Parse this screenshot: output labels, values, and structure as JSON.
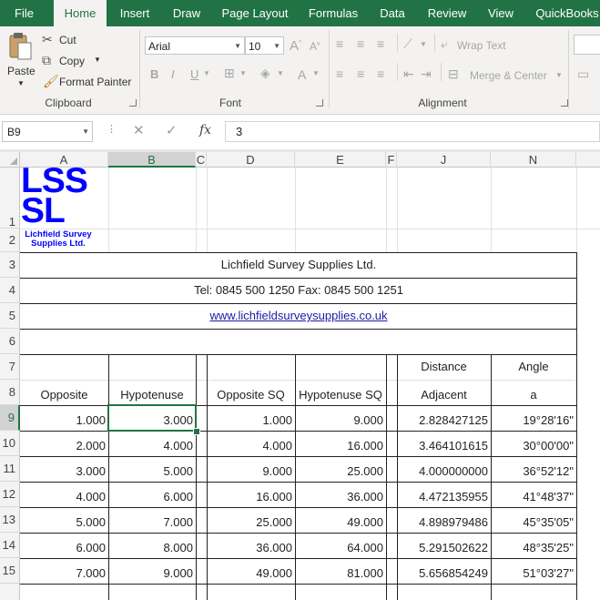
{
  "ribbon": {
    "tabs": [
      "File",
      "Home",
      "Insert",
      "Draw",
      "Page Layout",
      "Formulas",
      "Data",
      "Review",
      "View",
      "QuickBooks"
    ],
    "active_tab": "Home",
    "clipboard": {
      "paste": "Paste",
      "cut": "Cut",
      "copy": "Copy",
      "format_painter": "Format Painter",
      "label": "Clipboard"
    },
    "font": {
      "name": "Arial",
      "size": "10",
      "label": "Font",
      "bold": "B",
      "italic": "I",
      "underline": "U"
    },
    "alignment": {
      "wrap_text": "Wrap Text",
      "merge_center": "Merge & Center",
      "label": "Alignment"
    }
  },
  "formula_bar": {
    "name_box": "B9",
    "value": "3",
    "fx": "fx"
  },
  "columns": [
    "A",
    "B",
    "C",
    "D",
    "E",
    "F",
    "J",
    "N"
  ],
  "selected_column": "B",
  "rows": [
    "1",
    "2",
    "3",
    "4",
    "5",
    "6",
    "7",
    "8",
    "9",
    "10",
    "11",
    "12",
    "13",
    "14",
    "15"
  ],
  "selected_row": "9",
  "logo": {
    "letters_top": "LSS",
    "letters_bottom": "SL",
    "name_line1": "Lichfield Survey",
    "name_line2": "Supplies Ltd.",
    "color": "#0000ff"
  },
  "sheet": {
    "company": "Lichfield Survey Supplies Ltd.",
    "phone": "Tel: 0845 500 1250  Fax: 0845 500 1251",
    "website": "www.lichfieldsurveysupplies.co.uk",
    "headers_row7": {
      "J": "Distance",
      "N": "Angle"
    },
    "headers_row8": {
      "A": "Opposite",
      "B": "Hypotenuse",
      "D": "Opposite SQ",
      "E": "Hypotenuse SQ",
      "J": "Adjacent",
      "N": "a"
    },
    "data": [
      {
        "A": "1.000",
        "B": "3.000",
        "D": "1.000",
        "E": "9.000",
        "J": "2.828427125",
        "N": "19°28'16\""
      },
      {
        "A": "2.000",
        "B": "4.000",
        "D": "4.000",
        "E": "16.000",
        "J": "3.464101615",
        "N": "30°00'00\""
      },
      {
        "A": "3.000",
        "B": "5.000",
        "D": "9.000",
        "E": "25.000",
        "J": "4.000000000",
        "N": "36°52'12\""
      },
      {
        "A": "4.000",
        "B": "6.000",
        "D": "16.000",
        "E": "36.000",
        "J": "4.472135955",
        "N": "41°48'37\""
      },
      {
        "A": "5.000",
        "B": "7.000",
        "D": "25.000",
        "E": "49.000",
        "J": "4.898979486",
        "N": "45°35'05\""
      },
      {
        "A": "6.000",
        "B": "8.000",
        "D": "36.000",
        "E": "64.000",
        "J": "5.291502622",
        "N": "48°35'25\""
      },
      {
        "A": "7.000",
        "B": "9.000",
        "D": "49.000",
        "E": "81.000",
        "J": "5.656854249",
        "N": "51°03'27\""
      }
    ]
  }
}
